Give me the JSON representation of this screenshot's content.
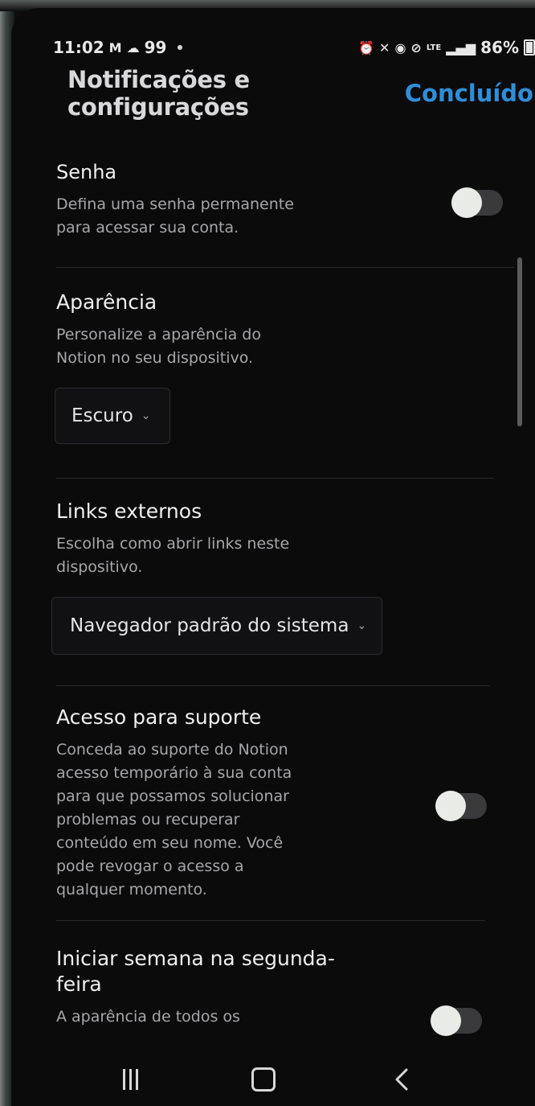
{
  "status_bar": {
    "time": "11:02",
    "notif_count": "99",
    "battery": "86%",
    "icons": [
      "gmail-icon",
      "cloud-icon",
      "alarm-icon",
      "mute-icon",
      "wifi-icon",
      "dnd-icon",
      "volte-icon",
      "signal-icon",
      "battery-icon"
    ]
  },
  "header": {
    "title": "Notificações e configurações",
    "done": "Concluído"
  },
  "password": {
    "title": "Senha",
    "desc_line1": "Defina uma senha permanente",
    "desc_line2": "para acessar sua conta.",
    "enabled": false
  },
  "appearance": {
    "title": "Aparência",
    "desc_line1": "Personalize a aparência do",
    "desc_line2": "Notion no seu dispositivo.",
    "value": "Escuro"
  },
  "external_links": {
    "title": "Links externos",
    "desc_line1": "Escolha como abrir links neste",
    "desc_line2": "dispositivo.",
    "value": "Navegador padrão do sistema"
  },
  "support_access": {
    "title": "Acesso para suporte",
    "desc_lines": [
      "Conceda ao suporte do Notion",
      "acesso temporário à sua conta",
      "para que possamos solucionar",
      "problemas ou recuperar",
      "conteúdo em seu nome. Você",
      "pode revogar o acesso a",
      "qualquer momento."
    ],
    "enabled": false
  },
  "start_week_monday": {
    "title_line1": "Iniciar semana na segunda-",
    "title_line2": "feira",
    "desc_line1": "A aparência de todos os",
    "enabled": false
  },
  "colors": {
    "accent": "#2f8ed8",
    "background": "#0b0b0c",
    "toggle_track": "#3a3a3d"
  }
}
